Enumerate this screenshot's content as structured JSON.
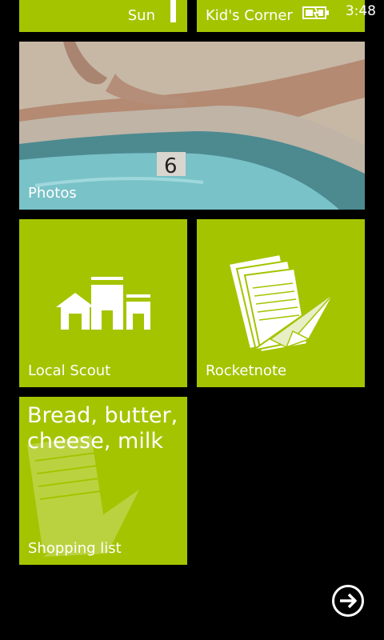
{
  "status_bar": {
    "time": "3:48",
    "battery_icon": "battery-charging-icon"
  },
  "tiles": {
    "sun": {
      "label": "Sun"
    },
    "kids_corner": {
      "label": "Kid's Corner"
    },
    "photos": {
      "label": "Photos"
    },
    "local_scout": {
      "label": "Local Scout",
      "icon": "buildings-icon"
    },
    "rocketnote": {
      "label": "Rocketnote",
      "icon": "paper-plane-notes-icon"
    },
    "shopping_list": {
      "label": "Shopping list",
      "note": "Bread, butter, cheese, milk"
    }
  },
  "navigation": {
    "arrow_icon": "arrow-right-circle-icon"
  },
  "colors": {
    "accent": "#a4c400",
    "background": "#000000",
    "text": "#ffffff"
  }
}
